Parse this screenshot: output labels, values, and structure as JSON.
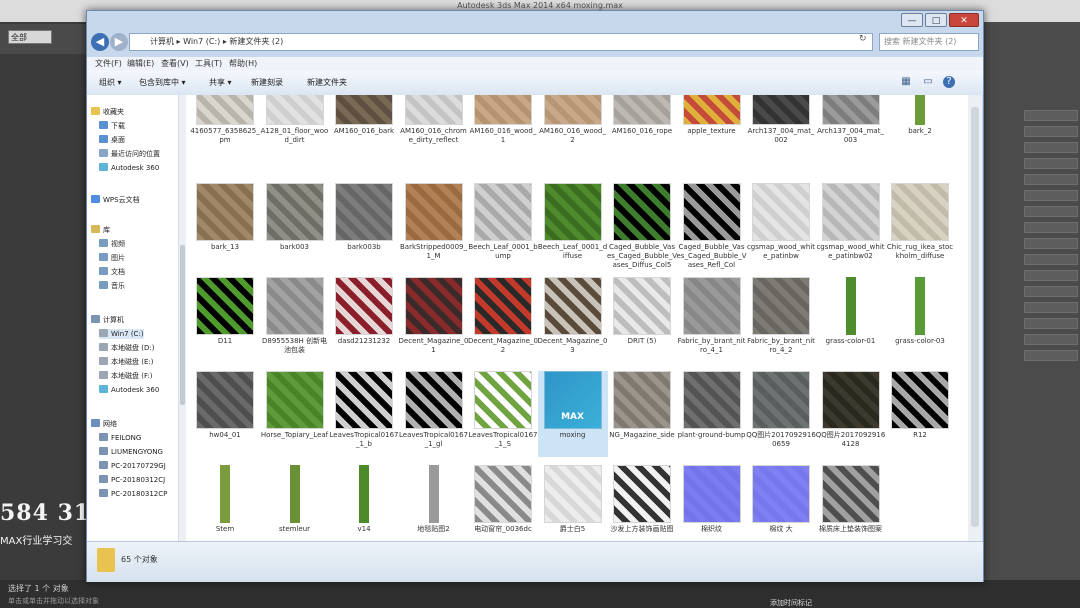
{
  "max": {
    "title": "Autodesk 3ds Max 2014 x64   moxing.max",
    "dropdown": "全部",
    "watermark_number": "584 31",
    "watermark_text": "MAX行业学习交",
    "status": "选择了 1 个 对象",
    "status_hint": "单击或单击并拖动以选择对象",
    "bottom_right": "添加时间标记"
  },
  "explorer": {
    "window_controls": {
      "minimize": "—",
      "maximize": "□",
      "close": "✕"
    },
    "address_path": "计算机 ▸ Win7 (C:) ▸ 新建文件夹 (2)",
    "search_placeholder": "搜索 新建文件夹 (2)",
    "menu": [
      "文件(F)",
      "编辑(E)",
      "查看(V)",
      "工具(T)",
      "帮助(H)"
    ],
    "commands": [
      "组织 ▾",
      "包含到库中 ▾",
      "共享 ▾",
      "新建刻录",
      "新建文件夹"
    ],
    "nav": [
      {
        "label": "收藏夹",
        "color": "#e8c34f",
        "indent": 0
      },
      {
        "label": "下载",
        "color": "#5a8fd0",
        "indent": 1
      },
      {
        "label": "桌面",
        "color": "#5a8fd0",
        "indent": 1
      },
      {
        "label": "最近访问的位置",
        "color": "#8aa6c6",
        "indent": 1
      },
      {
        "label": "Autodesk 360",
        "color": "#5fb3d6",
        "indent": 1
      },
      {
        "label": "WPS云文档",
        "color": "#4f8de0",
        "indent": 0
      },
      {
        "label": "库",
        "color": "#d8b65a",
        "indent": 0
      },
      {
        "label": "视频",
        "color": "#7a9bc0",
        "indent": 1
      },
      {
        "label": "图片",
        "color": "#7a9bc0",
        "indent": 1
      },
      {
        "label": "文档",
        "color": "#7a9bc0",
        "indent": 1
      },
      {
        "label": "音乐",
        "color": "#7a9bc0",
        "indent": 1
      },
      {
        "label": "计算机",
        "color": "#7c93b3",
        "indent": 0
      },
      {
        "label": "Win7 (C:)",
        "color": "#9aa6b4",
        "indent": 1
      },
      {
        "label": "本地磁盘 (D:)",
        "color": "#9aa6b4",
        "indent": 1
      },
      {
        "label": "本地磁盘 (E:)",
        "color": "#9aa6b4",
        "indent": 1
      },
      {
        "label": "本地磁盘 (F:)",
        "color": "#9aa6b4",
        "indent": 1
      },
      {
        "label": "Autodesk 360",
        "color": "#5fb3d6",
        "indent": 1
      },
      {
        "label": "网络",
        "color": "#6b8fbf",
        "indent": 0
      },
      {
        "label": "FEILONG",
        "color": "#7c93b3",
        "indent": 1
      },
      {
        "label": "LIUMENGYONG",
        "color": "#7c93b3",
        "indent": 1
      },
      {
        "label": "PC-20170729GJ",
        "color": "#7c93b3",
        "indent": 1
      },
      {
        "label": "PC-20180312CJ",
        "color": "#7c93b3",
        "indent": 1
      },
      {
        "label": "PC-20180312CP",
        "color": "#7c93b3",
        "indent": 1
      }
    ],
    "files": [
      {
        "name": "4160577_6358625_pm",
        "tex": "#d9d6d0",
        "alt": "#b9b4aa"
      },
      {
        "name": "A128_01_floor_wood_dirt",
        "tex": "#e2e2e2",
        "alt": "#cfcfcf"
      },
      {
        "name": "AM160_016_bark",
        "tex": "#7a6a55",
        "alt": "#5e5040"
      },
      {
        "name": "AM160_016_chrome_dirty_reflect",
        "tex": "#dcdcdc",
        "alt": "#c4c4c4"
      },
      {
        "name": "AM160_016_wood_1",
        "tex": "#c8a784",
        "alt": "#b69270"
      },
      {
        "name": "AM160_016_wood_2",
        "tex": "#c9a88a",
        "alt": "#b79674"
      },
      {
        "name": "AM160_016_rope",
        "tex": "#bdb9b2",
        "alt": "#a6a29b"
      },
      {
        "name": "apple_texture",
        "tex": "#e0b13a",
        "alt": "#c44b3a"
      },
      {
        "name": "Arch137_004_mat_002",
        "tex": "#4a4a4a",
        "alt": "#333333"
      },
      {
        "name": "Arch137_004_mat_003",
        "tex": "#9a9a9a",
        "alt": "#7d7d7d"
      },
      {
        "name": "bark_2",
        "tex": "#ffffff",
        "alt": "#6e9b3a",
        "narrow": true
      },
      {
        "name": "bark_13",
        "tex": "#a08868",
        "alt": "#86704f"
      },
      {
        "name": "bark003",
        "tex": "#8f8f86",
        "alt": "#6e6e66"
      },
      {
        "name": "bark003b",
        "tex": "#7c7c7c",
        "alt": "#666666"
      },
      {
        "name": "BarkStripped0009_1_M",
        "tex": "#b38156",
        "alt": "#9a6b43"
      },
      {
        "name": "Beech_Leaf_0001_bump",
        "tex": "#cfcfcf",
        "alt": "#a9a9a9"
      },
      {
        "name": "Beech_Leaf_0001_diffuse",
        "tex": "#4f8a2c",
        "alt": "#3a6d1f"
      },
      {
        "name": "Caged_Bubble_Vases_Caged_Bubble_Vases_Diffus_Col5",
        "tex": "#000000",
        "alt": "#3e7d2e"
      },
      {
        "name": "Caged_Bubble_Vases_Caged_Bubble_Vases_Refl_Col",
        "tex": "#000000",
        "alt": "#9a9a9a"
      },
      {
        "name": "cgsmap_wood_white_patinbw",
        "tex": "#e4e4e4",
        "alt": "#cfcfcf"
      },
      {
        "name": "cgsmap_wood_white_patinbw02",
        "tex": "#d3d3d3",
        "alt": "#b7b7b7"
      },
      {
        "name": "Chic_rug_ikea_stockholm_diffuse",
        "tex": "#d8d2c4",
        "alt": "#c2bba9"
      },
      {
        "name": "D11",
        "tex": "#000000",
        "alt": "#4f9a2d"
      },
      {
        "name": "D8955538H 创新电池包装",
        "tex": "#a3a3a3",
        "alt": "#8a8a8a"
      },
      {
        "name": "dasd21231232",
        "tex": "#8b1e2b",
        "alt": "#e6d6d6"
      },
      {
        "name": "Decent_Magazine_01",
        "tex": "#3a2a2a",
        "alt": "#8a2b2b"
      },
      {
        "name": "Decent_Magazine_02",
        "tex": "#c43a2a",
        "alt": "#2a2a2a"
      },
      {
        "name": "Decent_Magazine_03",
        "tex": "#5a4a3a",
        "alt": "#c9c2b8"
      },
      {
        "name": "DRIT (5)",
        "tex": "#bdbdbd",
        "alt": "#e8e8e8"
      },
      {
        "name": "Fabric_by_brant_nitro_4_1",
        "tex": "#9a9a9a",
        "alt": "#878787"
      },
      {
        "name": "Fabric_by_brant_nitro_4_2",
        "tex": "#7e7a74",
        "alt": "#696661"
      },
      {
        "name": "grass-color-01",
        "tex": "#ffffff",
        "alt": "#4e8d2e",
        "narrow": true
      },
      {
        "name": "grass-color-03",
        "tex": "#ffffff",
        "alt": "#5a9a36",
        "narrow": true
      },
      {
        "name": "hw04_01",
        "tex": "#6a6a6a",
        "alt": "#4e4e4e"
      },
      {
        "name": "Horse_Topiary_Leaf",
        "tex": "#5f9b3b",
        "alt": "#4a8429"
      },
      {
        "name": "LeavesTropical0167_1_b",
        "tex": "#000000",
        "alt": "#cfcfcf"
      },
      {
        "name": "LeavesTropical0167_1_gl",
        "tex": "#000000",
        "alt": "#b0b0b0"
      },
      {
        "name": "LeavesTropical0167_1_S",
        "tex": "#ffffff",
        "alt": "#6fa440"
      },
      {
        "name": "moxing",
        "tex": "#2f95c8",
        "alt": "#3bb0d8",
        "max": true
      },
      {
        "name": "NG_Magazine_side",
        "tex": "#9b948b",
        "alt": "#7f786f"
      },
      {
        "name": "plant-ground-bump",
        "tex": "#6f6f6f",
        "alt": "#535353"
      },
      {
        "name": "QQ图片20170929160659",
        "tex": "#6e7273",
        "alt": "#5a5e5f"
      },
      {
        "name": "QQ图片20170929164128",
        "tex": "#3b3a2c",
        "alt": "#2a291f"
      },
      {
        "name": "R12",
        "tex": "#000000",
        "alt": "#a8a8a8"
      },
      {
        "name": "Stem",
        "tex": "#ffffff",
        "alt": "#7a9b3e",
        "narrow": true
      },
      {
        "name": "stemleur",
        "tex": "#ffffff",
        "alt": "#6b9136",
        "narrow": true
      },
      {
        "name": "v14",
        "tex": "#ffffff",
        "alt": "#4c8a2a",
        "narrow": true
      },
      {
        "name": "地毯贴图2",
        "tex": "#ffffff",
        "alt": "#9a9a9a",
        "narrow": true
      },
      {
        "name": "电动窗帘_0036dc",
        "tex": "#8a8a8a",
        "alt": "#e0e0e0"
      },
      {
        "name": "爵士白5",
        "tex": "#ededed",
        "alt": "#d8d8d8"
      },
      {
        "name": "沙发上方装饰画贴图",
        "tex": "#f2f2f2",
        "alt": "#333333"
      },
      {
        "name": "棉织纹",
        "tex": "#7b7cf0",
        "alt": "#7374ea"
      },
      {
        "name": "棉纹 大",
        "tex": "#7f80f2",
        "alt": "#7677ec"
      },
      {
        "name": "棉质床上垫装饰图案",
        "tex": "#4e4e4e",
        "alt": "#a0a0a0"
      }
    ],
    "item_count": "65 个对象"
  }
}
